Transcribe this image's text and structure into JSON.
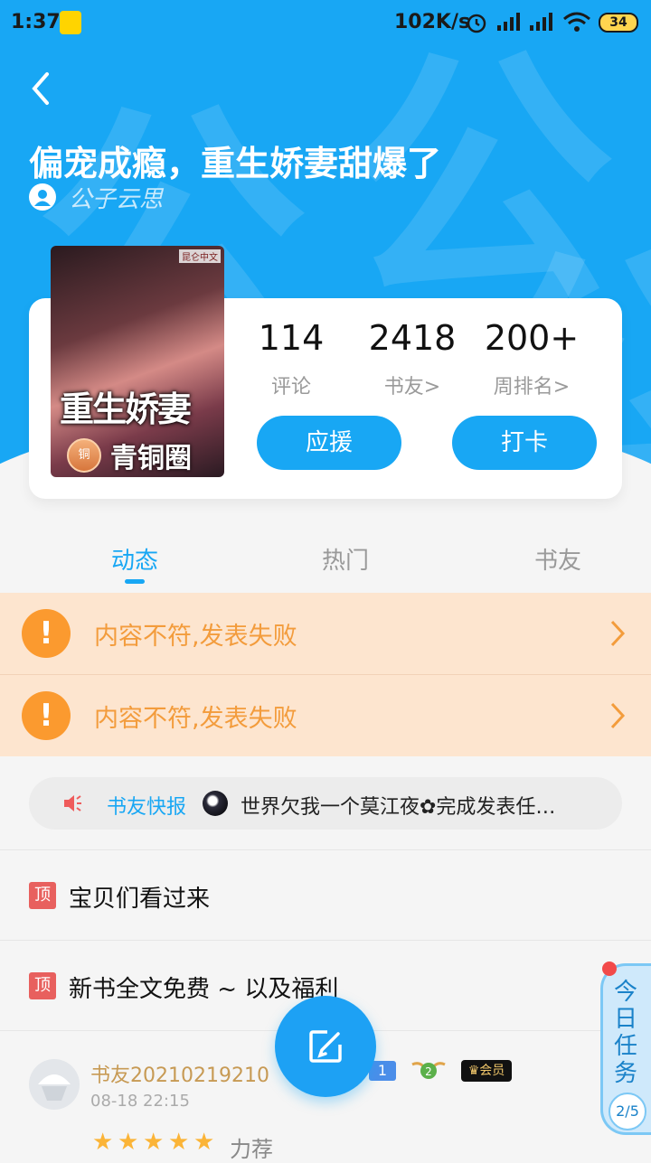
{
  "status_bar": {
    "time": "1:37",
    "network_speed": "102K/s",
    "battery": "34"
  },
  "header": {
    "title": "偏宠成瘾，重生娇妻甜爆了",
    "author": "公子云思",
    "watermark": "公"
  },
  "cover": {
    "title_text": "重生娇妻",
    "publisher": "昆仑中文",
    "circle_badge": "铜",
    "circle_name": "青铜圈"
  },
  "stats": [
    {
      "value": "114",
      "label": "评论"
    },
    {
      "value": "2418",
      "label": "书友>"
    },
    {
      "value": "200+",
      "label": "周排名>"
    }
  ],
  "buttons": {
    "support": "应援",
    "checkin": "打卡"
  },
  "tabs": [
    {
      "label": "动态",
      "active": true
    },
    {
      "label": "热门",
      "active": false
    },
    {
      "label": "书友",
      "active": false
    }
  ],
  "errors": [
    {
      "icon": "!",
      "message": "内容不符,发表失败"
    },
    {
      "icon": "!",
      "message": "内容不符,发表失败"
    }
  ],
  "news": {
    "label": "书友快报",
    "text": "世界欠我一个莫江夜✿完成发表任…"
  },
  "pinned": [
    {
      "tag": "顶",
      "title": "宝贝们看过来"
    },
    {
      "tag": "顶",
      "title": "新书全文免费 ~ 以及福利"
    }
  ],
  "post": {
    "user": "书友20210219210",
    "time": "08-18 22:15",
    "level": "1",
    "fan_level": "2",
    "vip": "会员",
    "stars": 5,
    "recommend": "力荐"
  },
  "task": {
    "label": "今日任务",
    "progress": "2/5"
  },
  "colors": {
    "primary": "#18a7f4",
    "warning_bg": "#fde5cf",
    "warning_text": "#f39c3c"
  }
}
